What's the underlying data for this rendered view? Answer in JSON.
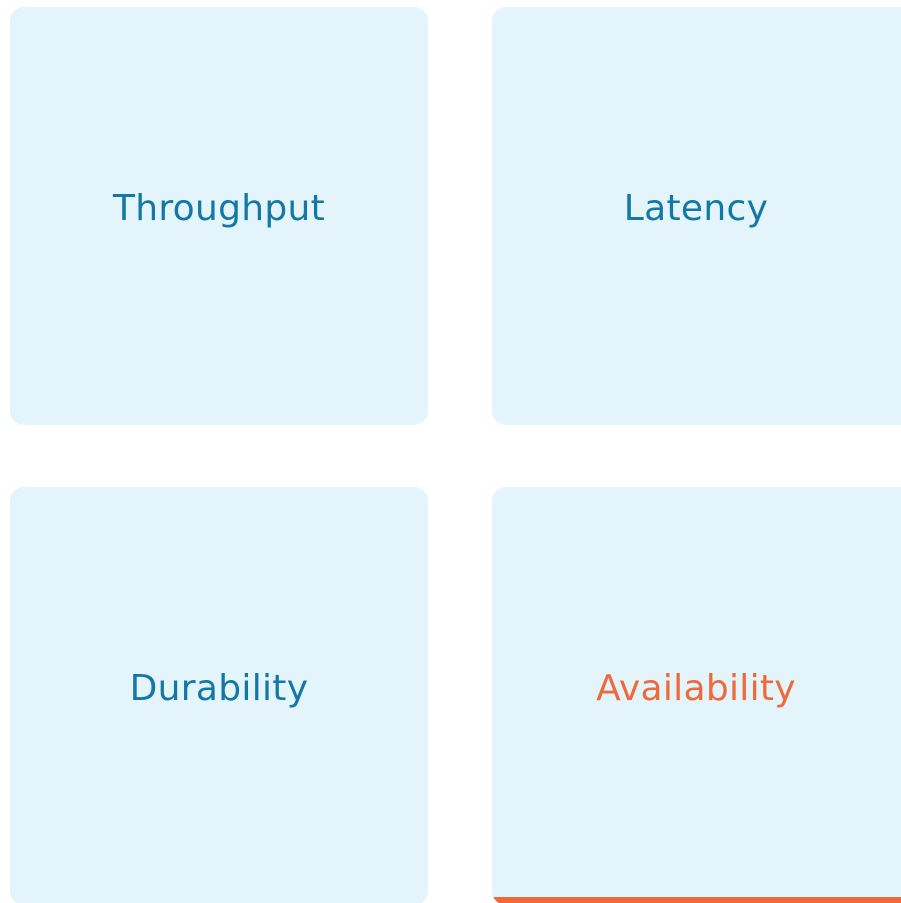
{
  "colors": {
    "tile_background": "#e4f4fb",
    "label_default": "#1378a6",
    "label_active": "#ee6a3c",
    "active_indicator": "#ee6a3c"
  },
  "tiles": [
    {
      "label": "Throughput",
      "active": false
    },
    {
      "label": "Latency",
      "active": false
    },
    {
      "label": "Durability",
      "active": false
    },
    {
      "label": "Availability",
      "active": true
    }
  ]
}
